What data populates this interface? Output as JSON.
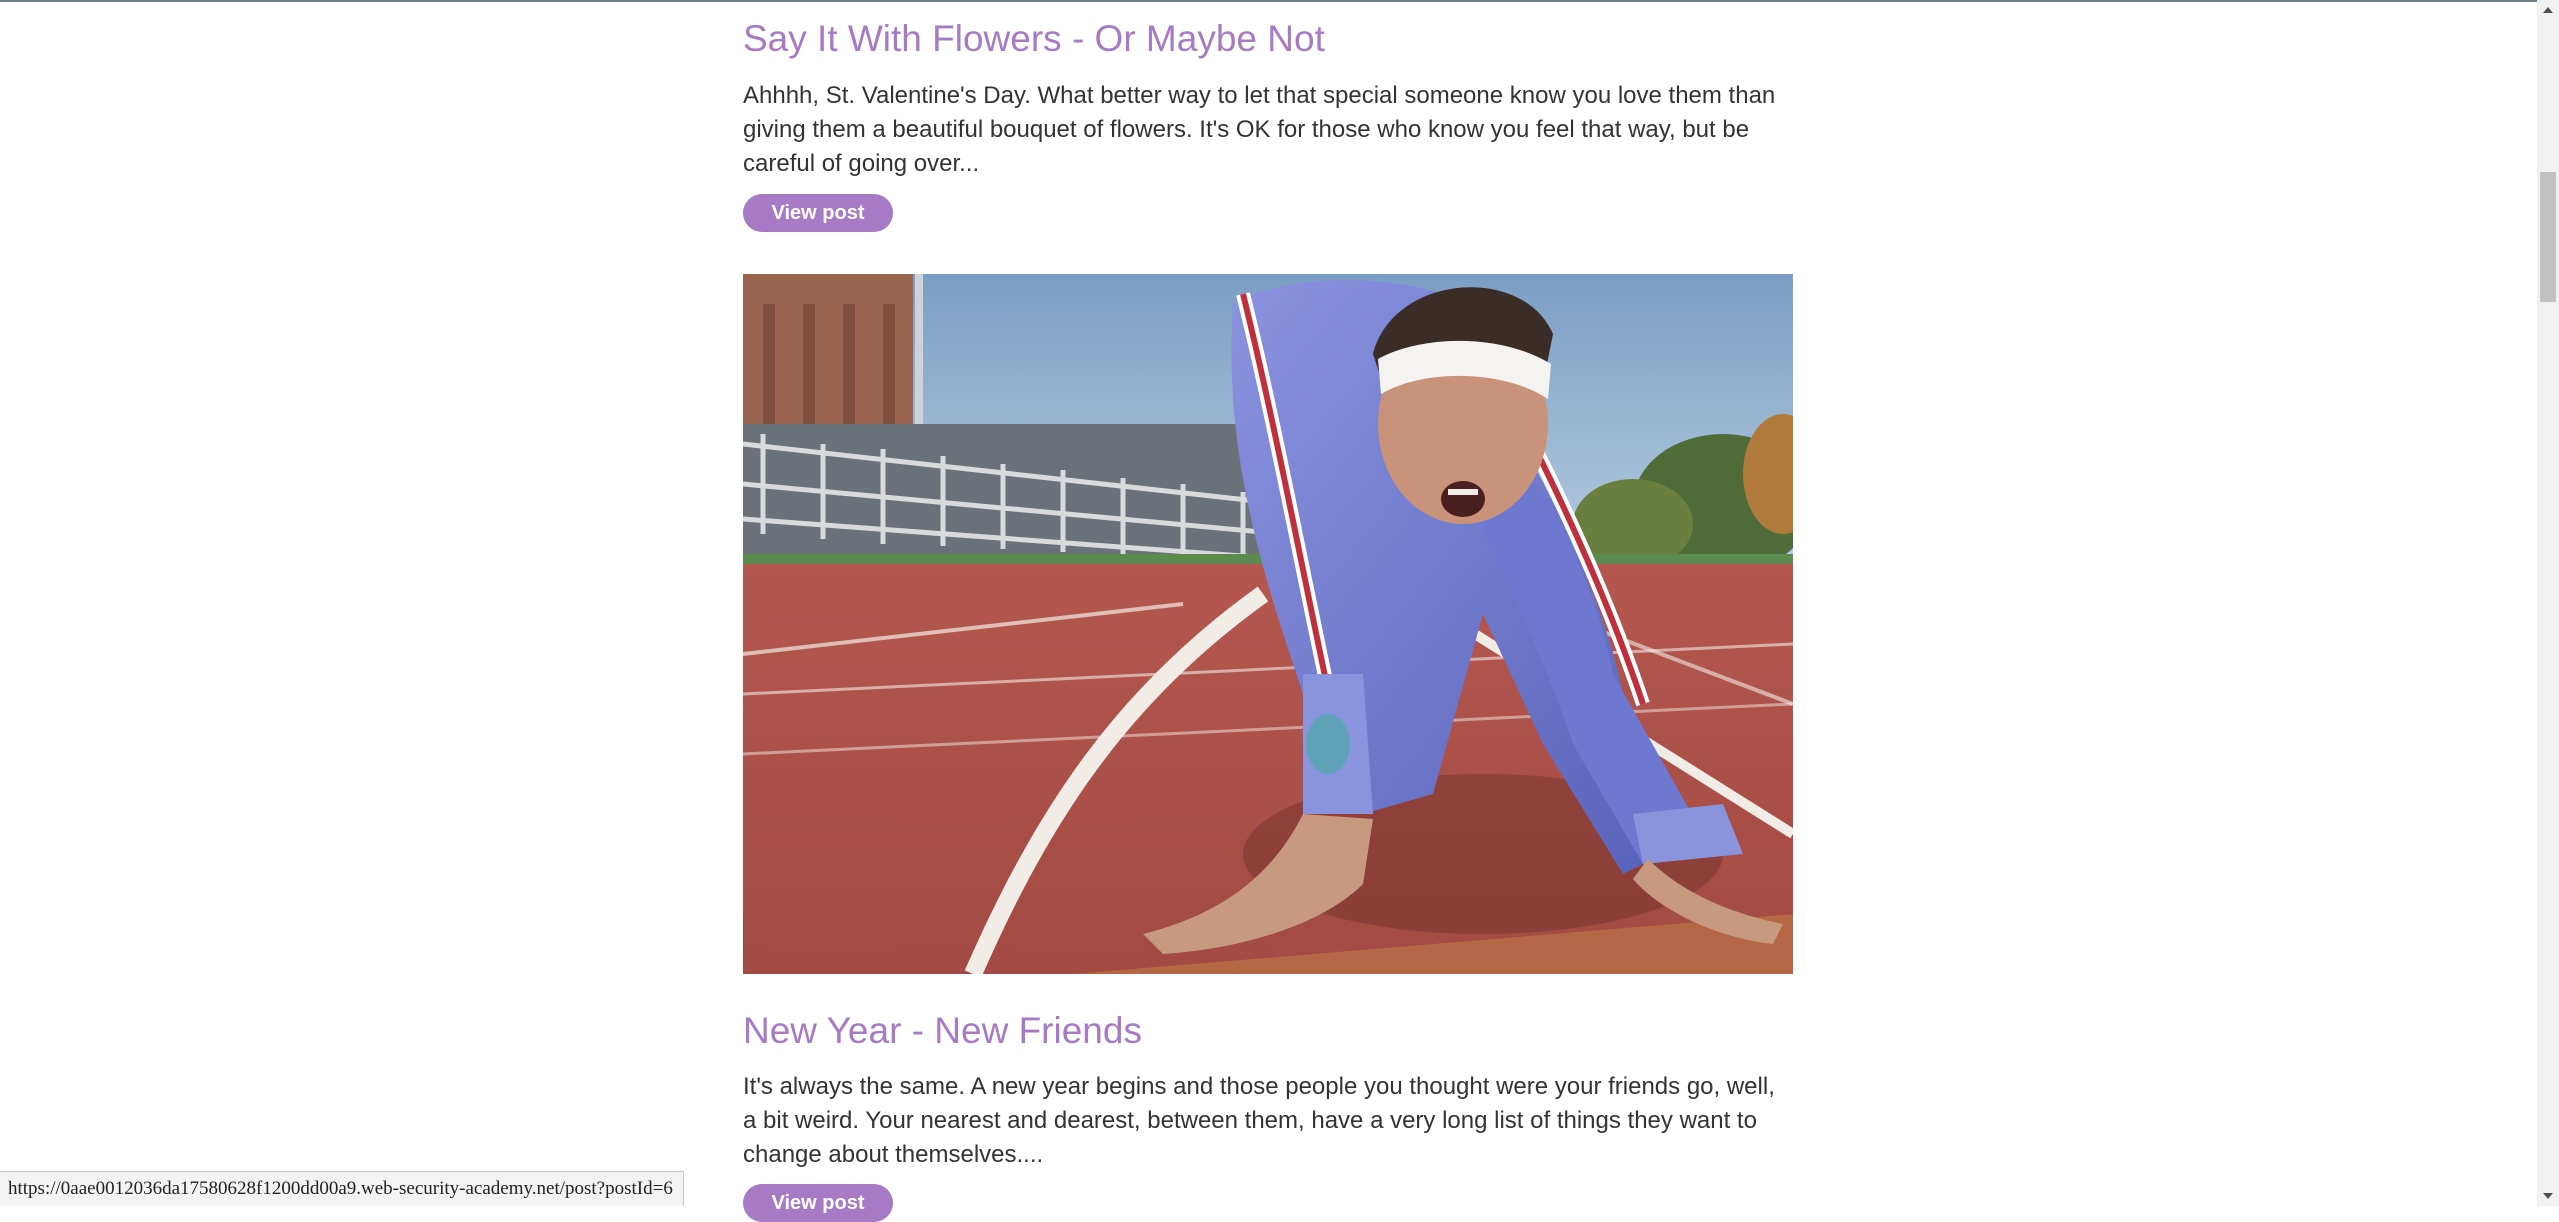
{
  "posts": [
    {
      "title": "Say It With Flowers - Or Maybe Not",
      "excerpt": "Ahhhh, St. Valentine's Day. What better way to let that special someone know you love them than giving them a beautiful bouquet of flowers. It's OK for those who know you feel that way, but be careful of going over...",
      "button_label": "View post"
    },
    {
      "title": "New Year - New Friends",
      "excerpt": "It's always the same. A new year begins and those people you thought were your friends go, well, a bit weird. Your nearest and dearest, between them, have a very long list of things they want to change about themselves....",
      "button_label": "View post"
    }
  ],
  "status_bar": {
    "url": "https://0aae0012036da17580628f1200dd00a9.web-security-academy.net/post?postId=6"
  },
  "colors": {
    "accent": "#a77ac6",
    "text": "#333332",
    "background": "#ffffff"
  }
}
